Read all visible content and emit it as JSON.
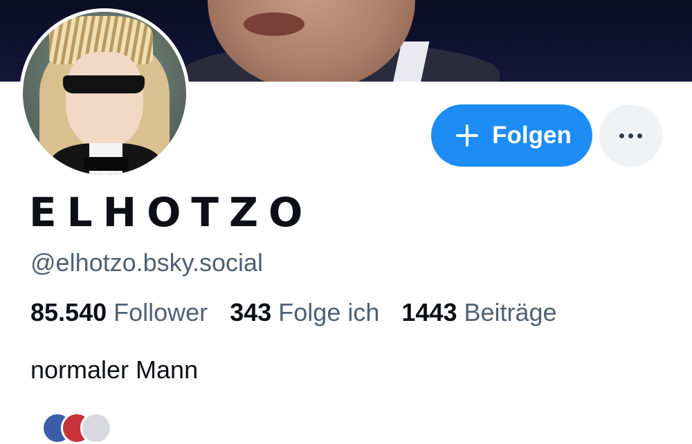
{
  "profile": {
    "display_name": "ELHOTZO",
    "handle": "@elhotzo.bsky.social",
    "bio": "normaler Mann"
  },
  "actions": {
    "follow_label": "Folgen",
    "follow_icon": "plus-icon",
    "more_icon": "more-options-icon"
  },
  "stats": [
    {
      "value": "85.540",
      "label": "Follower"
    },
    {
      "value": "343",
      "label": "Folge ich"
    },
    {
      "value": "1443",
      "label": "Beiträge"
    }
  ],
  "colors": {
    "accent": "#1e8cf5",
    "secondary_text": "#4d6174",
    "primary_text": "#0c1015",
    "more_button_bg": "#eef2f5"
  }
}
